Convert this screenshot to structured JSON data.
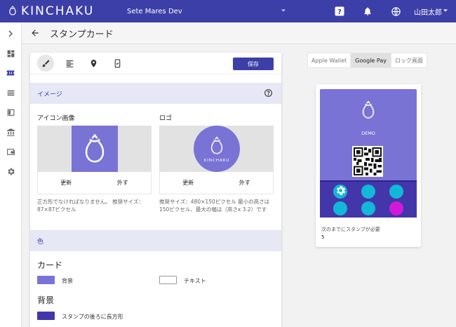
{
  "app": {
    "brand": "KINCHAKU",
    "workspace": "Sete Mares Dev",
    "user": "山田太郎"
  },
  "header": {
    "title": "スタンプカード"
  },
  "toolbar": {
    "save_label": "保存"
  },
  "image_section": {
    "title": "イメージ",
    "icon": {
      "label": "アイコン画像",
      "update": "更新",
      "remove": "外す",
      "hint": "正方形でなければなりません。 推奨サイズ：87×87ピクセル"
    },
    "logo": {
      "label": "ロゴ",
      "logo_text": "KINCHAKU",
      "update": "更新",
      "remove": "外す",
      "hint": "推奨サイズ：480×150ピクセル 最小の高さは150ピクセル、最大の幅は（高さx 3.2）です"
    }
  },
  "color_section": {
    "title": "色",
    "card_heading": "カード",
    "background_label": "背景",
    "text_label": "テキスト",
    "bg_heading": "背景",
    "stamp_bg_label": "スタンプの後ろに長方形",
    "colors": {
      "card_bg": "#7a73d6",
      "text": "#ffffff",
      "stamp_bg": "#4336aa"
    }
  },
  "preview": {
    "tabs": [
      "Apple Wallet",
      "Google Pay",
      "ロック画面"
    ],
    "selected_tab": "Google Pay",
    "card_name": "DEMO",
    "stamps_needed_label": "次のまでにスタンプが必要",
    "stamps_needed_value": "5"
  }
}
